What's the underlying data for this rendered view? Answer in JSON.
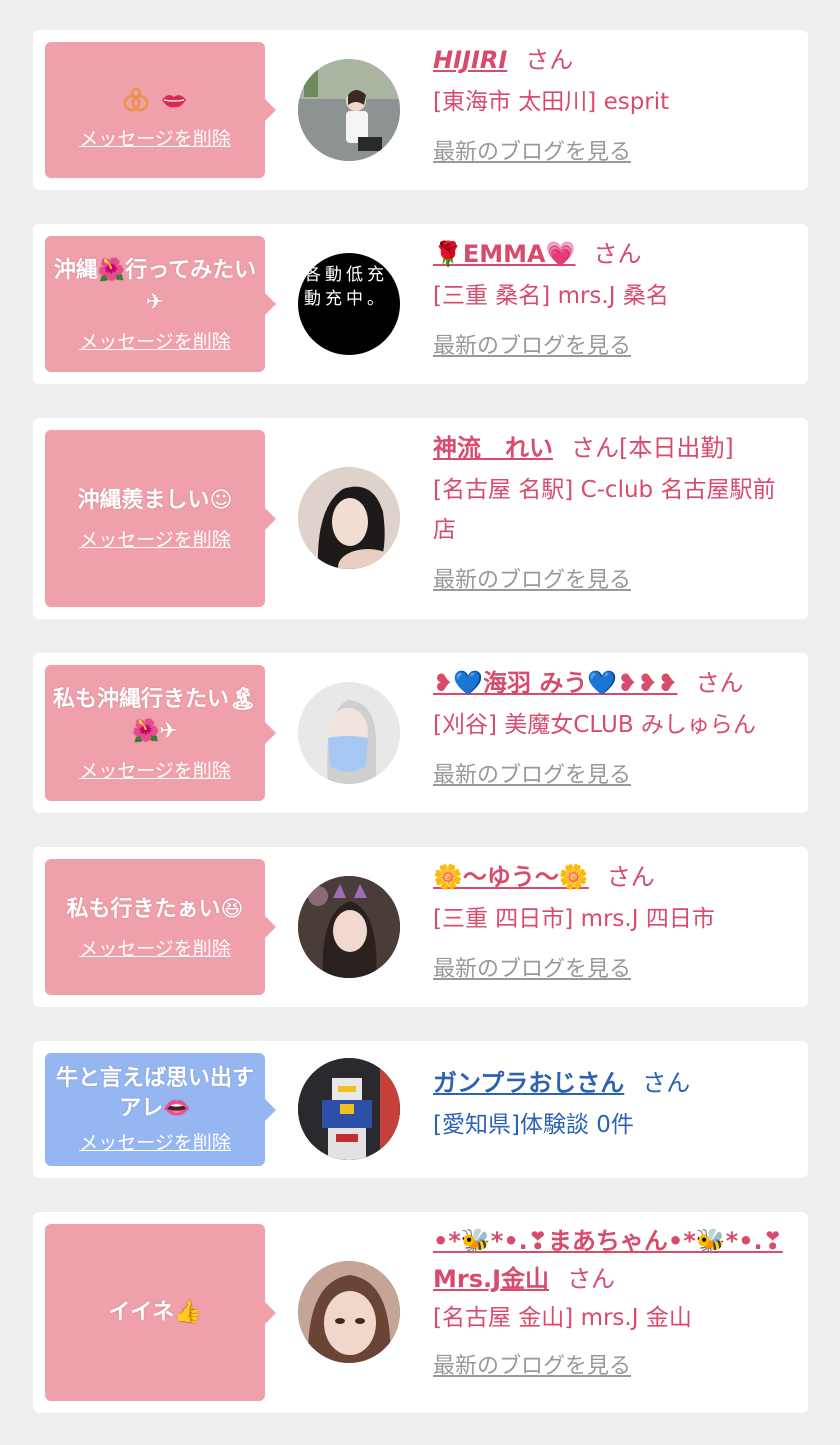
{
  "colors": {
    "pink_bubble": "#f0a0ab",
    "blue_bubble": "#96b6f2",
    "pink_text": "#d94b6c",
    "blue_text": "#2b62b4",
    "link_gray": "#999999",
    "background": "#eeeeee"
  },
  "cards": [
    {
      "message_text": "",
      "message_icons": [
        "sexy-emoji-icon",
        "lips-icon"
      ],
      "delete_label": "メッセージを削除",
      "name": "HIJIRI",
      "honorific": "さん",
      "shop": "[東海市 太田川] esprit",
      "blog_link": "最新のブログを見る"
    },
    {
      "message_text": "沖縄🌺行ってみたい✈",
      "delete_label": "メッセージを削除",
      "name": "🌹EMMA💗",
      "honorific": "さん",
      "shop": "[三重 桑名] mrs.J 桑名",
      "blog_link": "最新のブログを見る",
      "avatar_text": "各動低充動充中。"
    },
    {
      "message_text": "沖縄羨ましい☺",
      "delete_label": "メッセージを削除",
      "name": "神流　れい",
      "honorific": "さん[本日出勤]",
      "shop": "[名古屋 名駅] C-club 名古屋駅前店",
      "blog_link": "最新のブログを見る"
    },
    {
      "message_text": "私も沖縄行きたい🏝🌺✈",
      "delete_label": "メッセージを削除",
      "name": "❥💙海羽 みう💙❥❥❥",
      "honorific": "さん",
      "shop": "[刈谷] 美魔女CLUB みしゅらん",
      "blog_link": "最新のブログを見る"
    },
    {
      "message_text": "私も行きたぁい😆",
      "delete_label": "メッセージを削除",
      "name": "🌼〜ゆう〜🌼",
      "honorific": "さん",
      "shop": "[三重 四日市] mrs.J 四日市",
      "blog_link": "最新のブログを見る"
    },
    {
      "message_text": "牛と言えば思い出すアレ👄",
      "delete_label": "メッセージを削除",
      "name": "ガンプラおじさん",
      "honorific": "さん",
      "shop": "[愛知県]体験談 0件"
    },
    {
      "message_text": "イイネ👍",
      "delete_label": "",
      "name": "•*🐝*•.❣まあちゃん•*🐝*•.❣Mrs.J金山",
      "honorific": "さん",
      "shop": "[名古屋 金山] mrs.J 金山",
      "blog_link": "最新のブログを見る"
    }
  ]
}
